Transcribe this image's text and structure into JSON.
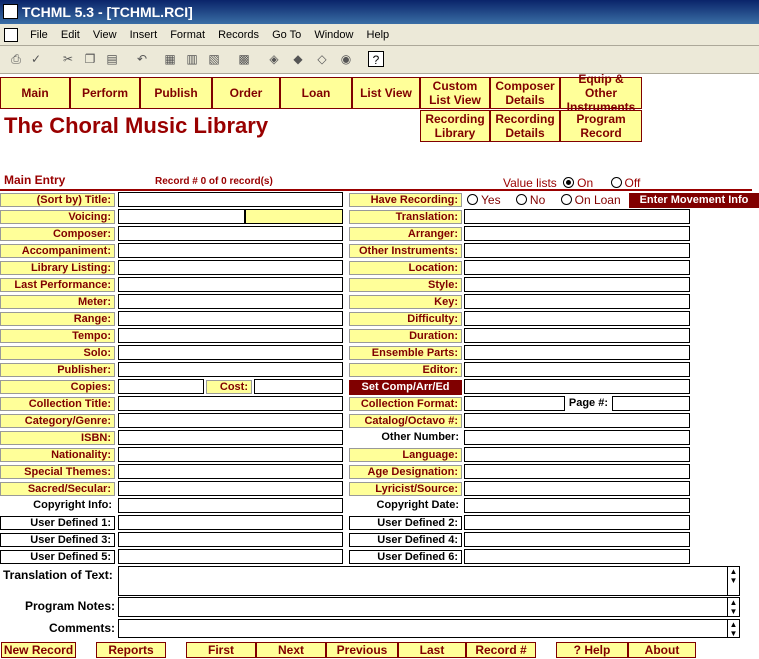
{
  "window": {
    "title": "TCHML 5.3 - [TCHML.RCI]"
  },
  "menu": [
    "File",
    "Edit",
    "View",
    "Insert",
    "Format",
    "Records",
    "Go To",
    "Window",
    "Help"
  ],
  "nav": {
    "main": "Main",
    "perform": "Perform",
    "publish": "Publish",
    "order": "Order",
    "loan": "Loan",
    "list_view": "List View",
    "custom_list_view": "Custom List View",
    "composer_details": "Composer Details",
    "equip_other": "Equip & Other Instruments",
    "recording_library": "Recording Library",
    "recording_details": "Recording Details",
    "program_record": "Program Record"
  },
  "app_title": "The Choral Music Library",
  "section_title": "Main Entry",
  "record_count": "Record # 0 of 0 record(s)",
  "value_lists": {
    "label": "Value lists",
    "on": "On",
    "off": "Off"
  },
  "have_recording": {
    "label": "Have Recording:",
    "yes": "Yes",
    "no": "No",
    "on_loan": "On Loan"
  },
  "enter_movement": "Enter Movement Info",
  "set_comp": "Set Comp/Arr/Ed",
  "left_labels": {
    "title": "(Sort by) Title:",
    "voicing": "Voicing:",
    "composer": "Composer:",
    "accompaniment": "Accompaniment:",
    "library_listing": "Library Listing:",
    "last_performance": "Last Performance:",
    "meter": "Meter:",
    "range": "Range:",
    "tempo": "Tempo:",
    "solo": "Solo:",
    "publisher": "Publisher:",
    "copies": "Copies:",
    "cost": "Cost:",
    "collection_title": "Collection Title:",
    "category": "Category/Genre:",
    "isbn": "ISBN:",
    "nationality": "Nationality:",
    "special_themes": "Special Themes:",
    "sacred": "Sacred/Secular:",
    "copyright_info": "Copyright Info:",
    "ud1": "User Defined 1:",
    "ud3": "User Defined 3:",
    "ud5": "User Defined 5:"
  },
  "right_labels": {
    "translation": "Translation:",
    "arranger": "Arranger:",
    "other_instruments": "Other Instruments:",
    "location": "Location:",
    "style": "Style:",
    "key": "Key:",
    "difficulty": "Difficulty:",
    "duration": "Duration:",
    "ensemble_parts": "Ensemble Parts:",
    "editor": "Editor:",
    "collection_format": "Collection Format:",
    "page": "Page #:",
    "catalog": "Catalog/Octavo #:",
    "other_number": "Other Number:",
    "language": "Language:",
    "age_designation": "Age Designation:",
    "lyricist": "Lyricist/Source:",
    "copyright_date": "Copyright Date:",
    "ud2": "User Defined 2:",
    "ud4": "User Defined 4:",
    "ud6": "User Defined 6:"
  },
  "big_labels": {
    "translation_text": "Translation of Text:",
    "program_notes": "Program Notes:",
    "comments": "Comments:"
  },
  "buttons": {
    "new_record": "New Record",
    "reports": "Reports",
    "first": "First",
    "next": "Next",
    "previous": "Previous",
    "last": "Last",
    "record_num": "Record #",
    "help": "? Help",
    "about": "About"
  }
}
